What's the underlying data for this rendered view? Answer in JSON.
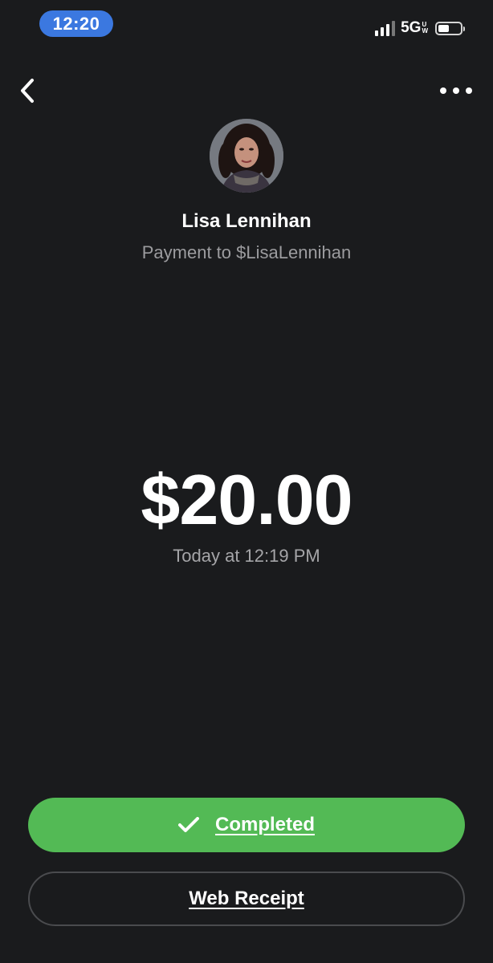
{
  "status_bar": {
    "time": "12:20",
    "network": "5G",
    "network_sub_top": "U",
    "network_sub_bottom": "W",
    "battery_level": 0.5
  },
  "nav": {
    "back_icon": "chevron-left-icon",
    "more_icon": "more-horizontal-icon"
  },
  "recipient": {
    "name": "Lisa Lennihan",
    "subtitle": "Payment to $LisaLennihan"
  },
  "payment": {
    "amount": "$20.00",
    "timestamp": "Today at 12:19 PM"
  },
  "actions": {
    "completed_label": "Completed",
    "completed_icon": "checkmark-icon",
    "web_receipt_label": "Web Receipt"
  },
  "colors": {
    "background": "#1a1b1d",
    "time_pill": "#3b78e0",
    "completed_green": "#53ba55",
    "secondary_text": "#9c9c9f"
  }
}
